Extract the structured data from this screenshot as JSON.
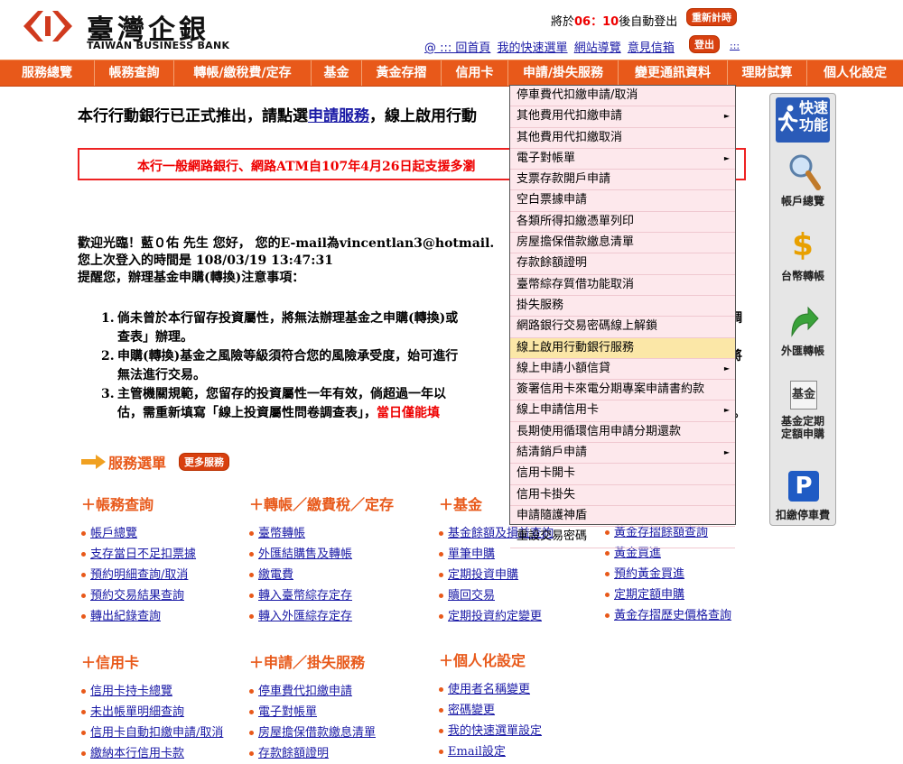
{
  "header": {
    "bank_name_cn": "臺灣企銀",
    "bank_name_en": "TAIWAN BUSINESS BANK",
    "session_prefix": "將於",
    "session_minutes": "06",
    "session_sep": "：",
    "session_seconds": "10",
    "session_suffix": "後自動登出",
    "renew_label": "重新計時",
    "logout_label": "登出",
    "links": [
      "@ ::: 回首頁",
      "我的快速選單",
      "網站導覽",
      "意見信箱"
    ],
    "tiny_link": ":::"
  },
  "nav": [
    "服務總覽",
    "帳務查詢",
    "轉帳/繳稅費/定存",
    "基金",
    "黃金存摺",
    "信用卡",
    "申請/掛失服務",
    "變更通訊資料",
    "理財試算",
    "個人化設定"
  ],
  "main": {
    "announce_prefix": "本行行動銀行已正式推出，請點選",
    "announce_link": "申請服務",
    "announce_suffix": "，線上啟用行動",
    "notice": "本行一般網路銀行、網路ATM自107年4月26日起支援多瀏",
    "welcome_line1": "歡迎光臨！藍０佑 先生 您好，  您的E-mail為vincentlan3@hotmail.",
    "welcome_line2": "您上次登入的時間是 108/03/19 13:47:31",
    "welcome_line3": "提醒您，辦理基金申購(轉換)注意事項：",
    "rules": [
      {
        "n": "1.",
        "l1": "倘未曾於本行留存投資屬性，將無法辦理基金之申購(轉換)或",
        "l1b": "調",
        "l2": "查表」辦理。"
      },
      {
        "n": "2.",
        "l1": "申購(轉換)基金之風險等級須符合您的風險承受度，始可進行",
        "l1b": "將",
        "l2": "無法進行交易。"
      },
      {
        "n": "3.",
        "l1": "主管機關規範，您留存的投資屬性一年有效，倘超過一年以",
        "l1b": "",
        "l2a": "估，需重新填寫「線上投資屬性問卷調查表」，",
        "l2red": "當日僅能填",
        "l2end": "。"
      }
    ]
  },
  "service_menu": {
    "title": "服務選單",
    "more_label": "更多服務",
    "columns": [
      {
        "title": "＋帳務查詢",
        "items": [
          "帳戶總覽",
          "支存當日不足扣票據",
          "預約明細查詢/取消",
          "預約交易結果查詢",
          "轉出紀錄查詢"
        ]
      },
      {
        "title": "＋轉帳／繳費稅／定存",
        "items": [
          "臺幣轉帳",
          "外匯結購售及轉帳",
          "繳電費",
          "轉入臺幣綜存定存",
          "轉入外匯綜存定存"
        ]
      },
      {
        "title": "＋基金",
        "items": [
          "基金餘額及損益查詢",
          "單筆申購",
          "定期投資申購",
          "贖回交易",
          "定期投資約定變更"
        ]
      },
      {
        "title": "",
        "items": [
          "黃金存摺餘額查詢",
          "黃金買進",
          "預約黃金買進",
          "定期定額申購",
          "黃金存摺歷史價格查詢"
        ]
      },
      {
        "title": "＋信用卡",
        "items": [
          "信用卡持卡總覽",
          "未出帳單明細查詢",
          "信用卡自動扣繳申請/取消",
          "繳納本行信用卡款"
        ]
      },
      {
        "title": "＋申請／掛失服務",
        "items": [
          "停車費代扣繳申請",
          "電子對帳單",
          "房屋擔保借款繳息清單",
          "存款餘額證明"
        ]
      },
      {
        "title": "＋個人化設定",
        "items": [
          "使用者名稱變更",
          "密碼變更",
          "我的快速選單設定",
          "Email設定"
        ]
      }
    ]
  },
  "dropdown": {
    "items": [
      {
        "label": "停車費代扣繳申請/取消",
        "sub": false
      },
      {
        "label": "其他費用代扣繳申請",
        "sub": true
      },
      {
        "label": "其他費用代扣繳取消",
        "sub": false
      },
      {
        "label": "電子對帳單",
        "sub": true
      },
      {
        "label": "支票存款開戶申請",
        "sub": false
      },
      {
        "label": "空白票據申請",
        "sub": false
      },
      {
        "label": "各類所得扣繳憑單列印",
        "sub": false
      },
      {
        "label": "房屋擔保借款繳息清單",
        "sub": false
      },
      {
        "label": "存款餘額證明",
        "sub": false
      },
      {
        "label": "臺幣綜存質借功能取消",
        "sub": false
      },
      {
        "label": "掛失服務",
        "sub": false
      },
      {
        "label": "網路銀行交易密碼線上解鎖",
        "sub": false
      },
      {
        "label": "線上啟用行動銀行服務",
        "sub": false,
        "active": true
      },
      {
        "label": "線上申請小額信貸",
        "sub": true
      },
      {
        "label": "簽署信用卡來電分期專案申請書約款",
        "sub": false
      },
      {
        "label": "線上申請信用卡",
        "sub": true
      },
      {
        "label": "長期使用循環信用申請分期還款",
        "sub": false
      },
      {
        "label": "結清銷戶申請",
        "sub": true
      },
      {
        "label": "信用卡開卡",
        "sub": false
      },
      {
        "label": "信用卡掛失",
        "sub": false
      },
      {
        "label": "申請隨護神盾",
        "sub": false
      },
      {
        "label": "重設交易密碼",
        "sub": false
      }
    ],
    "submenu_arrow": "►"
  },
  "quick_panel": {
    "title1": "快速",
    "title2": "功能",
    "items": [
      {
        "label": "帳戶總覽",
        "icon": "magnifier-icon"
      },
      {
        "label": "台幣轉帳",
        "icon": "dollar-icon"
      },
      {
        "label": "外匯轉帳",
        "icon": "arrow-icon"
      },
      {
        "label1": "基金定期",
        "label2": "定額申購",
        "icon": "fund-icon",
        "icon_text": "基金"
      },
      {
        "label": "扣繳停車費",
        "icon": "parking-icon",
        "icon_text": "P"
      }
    ]
  },
  "colors": {
    "nav": "#e8591a",
    "dropdown_bg": "#fde8ec",
    "active": "#fbe7a7",
    "link": "#1a1aa6",
    "alert": "#ee0000"
  }
}
